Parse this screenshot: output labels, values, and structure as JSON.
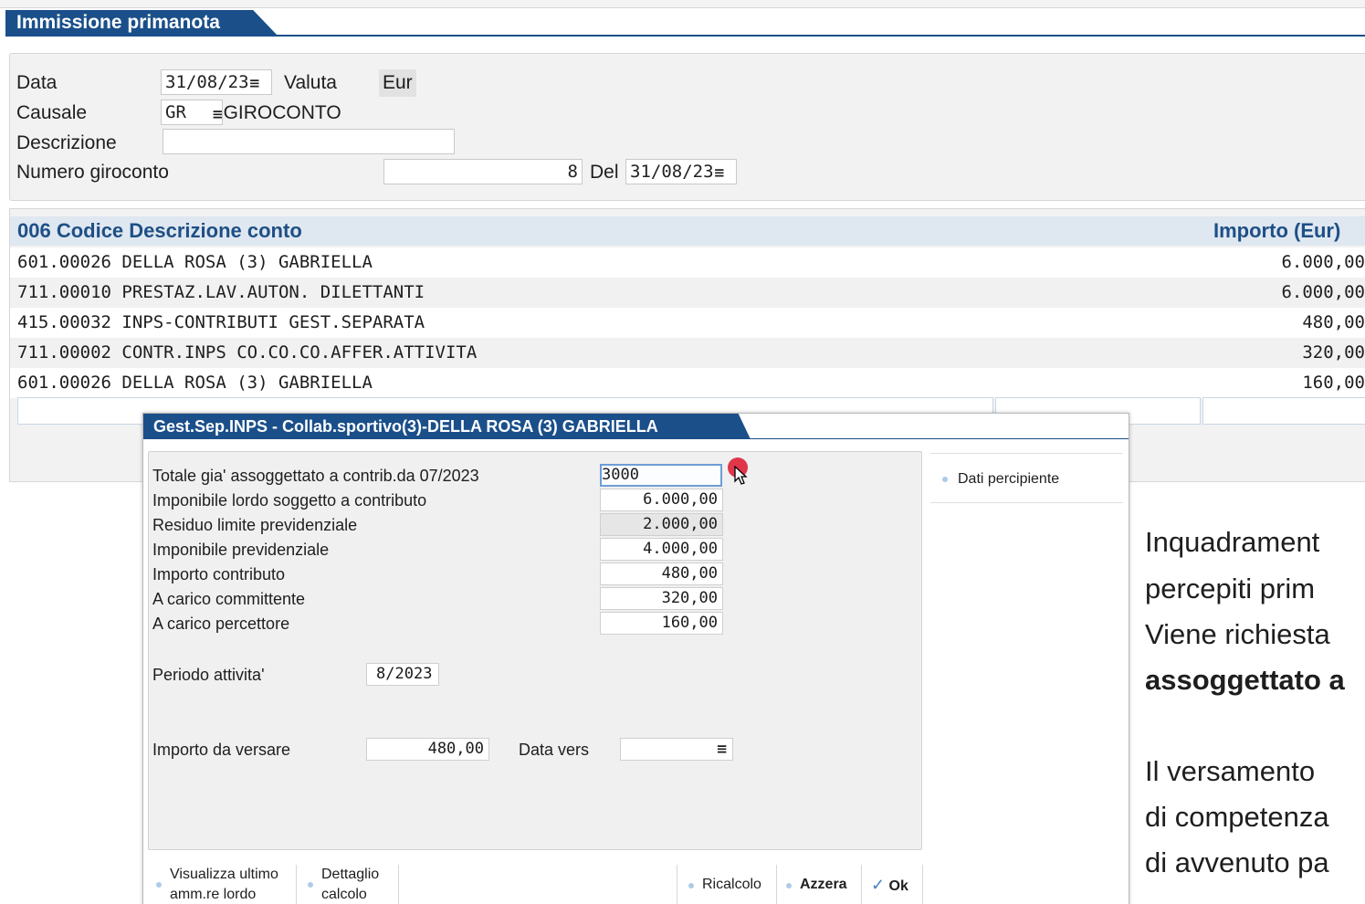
{
  "window": {
    "title": "Immissione primanota"
  },
  "header": {
    "data_label": "Data",
    "data_value": "31/08/23",
    "valuta_label": "Valuta",
    "valuta_value": "Eur",
    "causale_label": "Causale",
    "causale_code": "GR",
    "causale_desc": "GIROCONTO",
    "descrizione_label": "Descrizione",
    "descrizione_value": "",
    "numero_label": "Numero giroconto",
    "numero_value": "8",
    "del_label": "Del",
    "del_value": "31/08/23"
  },
  "grid": {
    "header_left": "006 Codice Descrizione conto",
    "header_right": "Importo (Eur)",
    "rows": [
      {
        "account": "601.00026 DELLA ROSA (3) GABRIELLA",
        "amount": "6.000,00"
      },
      {
        "account": "711.00010 PRESTAZ.LAV.AUTON. DILETTANTI",
        "amount": "6.000,00"
      },
      {
        "account": "415.00032 INPS-CONTRIBUTI GEST.SEPARATA",
        "amount": "480,00"
      },
      {
        "account": "711.00002 CONTR.INPS CO.CO.CO.AFFER.ATTIVITA",
        "amount": "320,00"
      },
      {
        "account": "601.00026 DELLA ROSA (3) GABRIELLA",
        "amount": "160,00"
      }
    ]
  },
  "dialog": {
    "title": "Gest.Sep.INPS - Collab.sportivo(3)-DELLA ROSA (3) GABRIELLA",
    "fields": [
      {
        "label": "Totale gia' assoggettato a contrib.da 07/2023",
        "value": "3000"
      },
      {
        "label": "Imponibile lordo soggetto a contributo",
        "value": "6.000,00"
      },
      {
        "label": "Residuo limite previdenziale",
        "value": "2.000,00"
      },
      {
        "label": "Imponibile previdenziale",
        "value": "4.000,00"
      },
      {
        "label": "Importo contributo",
        "value": "480,00"
      },
      {
        "label": "A carico committente",
        "value": "320,00"
      },
      {
        "label": "A carico percettore",
        "value": "160,00"
      }
    ],
    "periodo_label": "Periodo attivita'",
    "periodo_month": "8",
    "periodo_year": "2023",
    "importo_label": "Importo da versare",
    "importo_value": "480,00",
    "data_vers_label": "Data vers",
    "data_vers_value": "",
    "side_button": "Dati percipiente",
    "buttons": {
      "visualizza_line1": "Visualizza ultimo",
      "visualizza_line2": "amm.re lordo",
      "dettaglio_line1": "Dettaglio",
      "dettaglio_line2": "calcolo",
      "ricalcolo": "Ricalcolo",
      "azzera": "Azzera",
      "ok": "Ok"
    }
  },
  "note": {
    "line1": "Inquadrament",
    "line2": "percepiti prim",
    "line3": "Viene richiesta",
    "line4_bold": "assoggettato a",
    "line5": "Il versamento",
    "line6": "di competenza",
    "line7": "di avvenuto pa"
  },
  "colors": {
    "accent": "#1a4f8a",
    "header_bg": "#dfe7f0",
    "marker": "#e0364a"
  },
  "icons": {
    "calendar": "≡",
    "check": "✓"
  }
}
